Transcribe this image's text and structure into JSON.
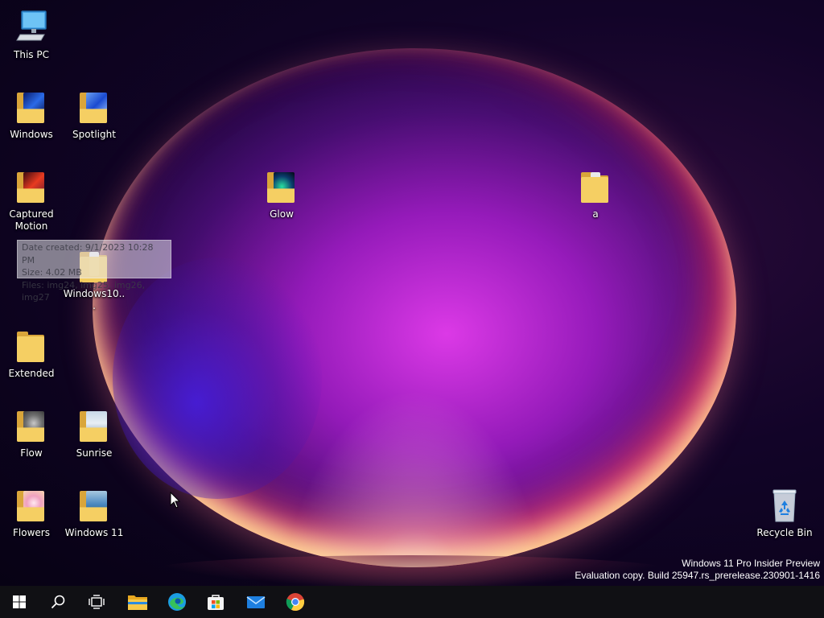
{
  "desktop": {
    "icons": [
      {
        "label": "This PC"
      },
      {
        "label": "Windows"
      },
      {
        "label": "Spotlight"
      },
      {
        "label": "Captured Motion"
      },
      {
        "label": "Glow"
      },
      {
        "label": "a"
      },
      {
        "label": "Windows10..."
      },
      {
        "label": "Extended"
      },
      {
        "label": "Flow"
      },
      {
        "label": "Sunrise"
      },
      {
        "label": "Flowers"
      },
      {
        "label": "Windows 11"
      },
      {
        "label": "Recycle Bin"
      }
    ],
    "tooltip": {
      "date_created": "Date created: 9/1/2023 10:28 PM",
      "size": "Size: 4.02 MB",
      "files": "Files: img24, img25, img26, img27"
    },
    "watermark": {
      "line1": "Windows 11 Pro Insider Preview",
      "line2": "Evaluation copy. Build 25947.rs_prerelease.230901-1416"
    }
  },
  "taskbar": {
    "items": [
      "windows-logo-icon",
      "search-icon",
      "task-view-icon",
      "file-explorer-icon",
      "edge-icon",
      "store-icon",
      "mail-icon",
      "chrome-icon"
    ]
  },
  "colors": {
    "taskbar_bg": "#101014",
    "folder": "#f5cf63",
    "accent": "#0078d4"
  }
}
